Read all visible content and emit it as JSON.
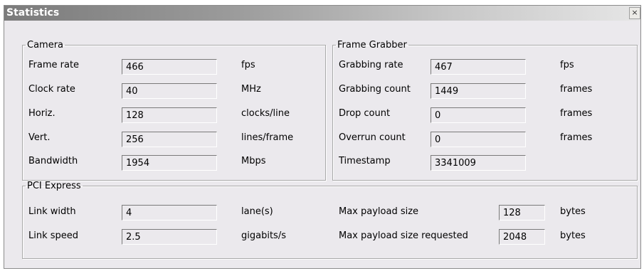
{
  "window": {
    "title": "Statistics",
    "close_glyph": "×"
  },
  "camera": {
    "legend": "Camera",
    "rows": [
      {
        "label": "Frame rate",
        "value": "466",
        "unit": "fps"
      },
      {
        "label": "Clock rate",
        "value": "40",
        "unit": "MHz"
      },
      {
        "label": "Horiz.",
        "value": "128",
        "unit": "clocks/line"
      },
      {
        "label": "Vert.",
        "value": "256",
        "unit": "lines/frame"
      },
      {
        "label": "Bandwidth",
        "value": "1954",
        "unit": "Mbps"
      }
    ]
  },
  "frame_grabber": {
    "legend": "Frame Grabber",
    "rows": [
      {
        "label": "Grabbing rate",
        "value": "467",
        "unit": "fps"
      },
      {
        "label": "Grabbing count",
        "value": "1449",
        "unit": "frames"
      },
      {
        "label": "Drop count",
        "value": "0",
        "unit": "frames"
      },
      {
        "label": "Overrun count",
        "value": "0",
        "unit": "frames"
      },
      {
        "label": "Timestamp",
        "value": "3341009",
        "unit": ""
      }
    ]
  },
  "pci_express": {
    "legend": "PCI Express",
    "left_rows": [
      {
        "label": "Link width",
        "value": "4",
        "unit": "lane(s)"
      },
      {
        "label": "Link speed",
        "value": "2.5",
        "unit": "gigabits/s"
      }
    ],
    "right_rows": [
      {
        "label": "Max payload size",
        "value": "128",
        "unit": "bytes"
      },
      {
        "label": "Max payload size requested",
        "value": "2048",
        "unit": "bytes"
      }
    ]
  }
}
